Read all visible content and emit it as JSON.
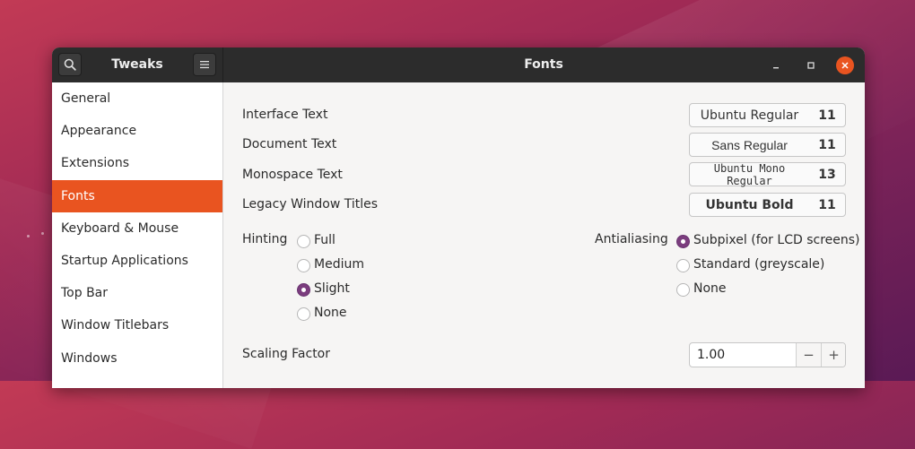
{
  "sidebar_header": {
    "title": "Tweaks",
    "search_icon": "search-icon",
    "menu_icon": "hamburger-menu-icon"
  },
  "header": {
    "title": "Fonts"
  },
  "window_controls": {
    "minimize": "minimize-icon",
    "maximize": "maximize-icon",
    "close": "close-icon"
  },
  "colors": {
    "accent": "#e95420",
    "radio_checked": "#7b3d7e"
  },
  "sidebar": {
    "items": [
      {
        "label": "General"
      },
      {
        "label": "Appearance"
      },
      {
        "label": "Extensions"
      },
      {
        "label": "Fonts",
        "active": true
      },
      {
        "label": "Keyboard & Mouse"
      },
      {
        "label": "Startup Applications"
      },
      {
        "label": "Top Bar"
      },
      {
        "label": "Window Titlebars"
      },
      {
        "label": "Windows"
      }
    ]
  },
  "fonts": {
    "interface": {
      "label": "Interface Text",
      "font": "Ubuntu Regular",
      "size": "11"
    },
    "document": {
      "label": "Document Text",
      "font": "Sans Regular",
      "size": "11"
    },
    "monospace": {
      "label": "Monospace Text",
      "font": "Ubuntu Mono Regular",
      "size": "13"
    },
    "legacy": {
      "label": "Legacy Window Titles",
      "font": "Ubuntu Bold",
      "size": "11"
    }
  },
  "hinting": {
    "label": "Hinting",
    "options": [
      {
        "label": "Full",
        "checked": false
      },
      {
        "label": "Medium",
        "checked": false
      },
      {
        "label": "Slight",
        "checked": true
      },
      {
        "label": "None",
        "checked": false
      }
    ]
  },
  "antialiasing": {
    "label": "Antialiasing",
    "options": [
      {
        "label": "Subpixel (for LCD screens)",
        "checked": true
      },
      {
        "label": "Standard (greyscale)",
        "checked": false
      },
      {
        "label": "None",
        "checked": false
      }
    ]
  },
  "scaling": {
    "label": "Scaling Factor",
    "value": "1.00",
    "decrement": "−",
    "increment": "+"
  }
}
